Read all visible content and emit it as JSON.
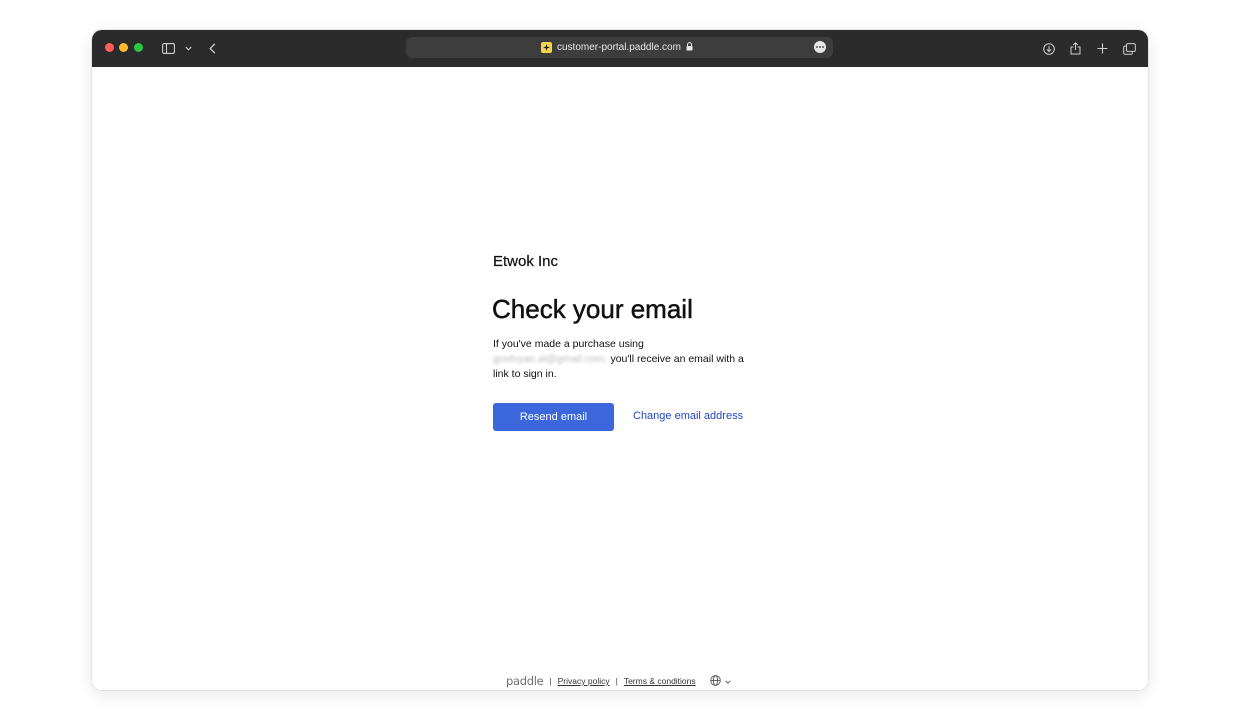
{
  "browser": {
    "url": "customer-portal.paddle.com",
    "icons": [
      "sidebar-icon",
      "chevron-down-icon",
      "back-icon",
      "lock-icon",
      "more-icon",
      "download-icon",
      "share-icon",
      "plus-icon",
      "tabs-icon"
    ]
  },
  "page": {
    "company": "Etwok Inc",
    "heading": "Check your email",
    "body_prefix": "If you've made a purchase using",
    "email": "govtvyan.al@gmail.com,",
    "body_suffix": "you'll receive an email with a link to sign in.",
    "resend_label": "Resend email",
    "change_label": "Change email address"
  },
  "footer": {
    "logo": "paddle",
    "separator": "|",
    "privacy": "Privacy policy",
    "terms": "Terms & conditions",
    "language_icon": "globe-icon"
  },
  "colors": {
    "primary_button": "#3b66dc",
    "link": "#2447c4",
    "toolbar": "#2b2b2b"
  }
}
